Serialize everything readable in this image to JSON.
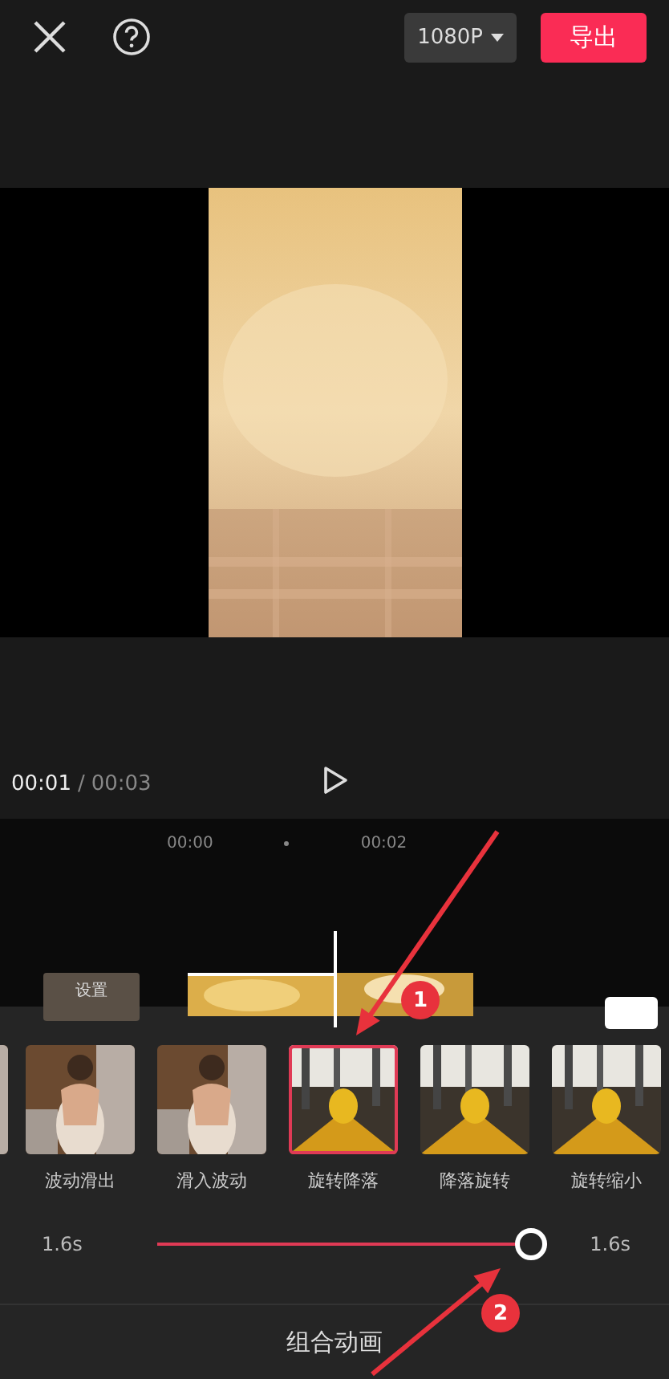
{
  "top_bar": {
    "resolution": "1080P",
    "export_button": "导出"
  },
  "player": {
    "current_time": "00:01",
    "separator": "/",
    "total_time": "00:03"
  },
  "timeline": {
    "ruler": [
      "00:00",
      "00:02"
    ],
    "cover_label": "设置"
  },
  "effects": [
    {
      "kind": "person",
      "selected": false
    },
    {
      "kind": "person",
      "label": "波动滑出",
      "selected": false
    },
    {
      "kind": "person",
      "label": "滑入波动",
      "selected": false
    },
    {
      "kind": "leaves",
      "label": "旋转降落",
      "selected": true
    },
    {
      "kind": "leaves",
      "label": "降落旋转",
      "selected": false
    },
    {
      "kind": "leaves",
      "label": "旋转缩小",
      "selected": false
    }
  ],
  "duration_slider": {
    "min_label": "1.6s",
    "level": 1.0,
    "value_label": "1.6s"
  },
  "panel_title": "组合动画",
  "annotations": [
    {
      "number": "1"
    },
    {
      "number": "2"
    }
  ]
}
